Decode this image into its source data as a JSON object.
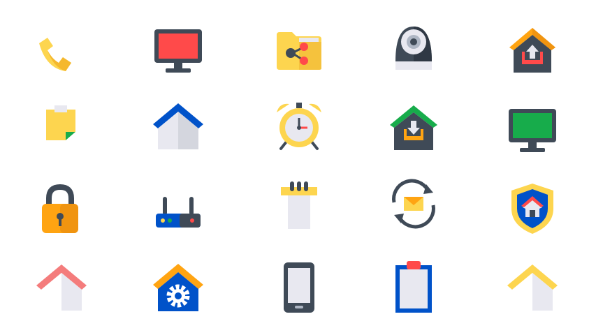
{
  "icons": [
    {
      "name": "phone-icon"
    },
    {
      "name": "monitor-red-icon"
    },
    {
      "name": "folder-share-icon"
    },
    {
      "name": "security-camera-icon"
    },
    {
      "name": "house-upload-icon"
    },
    {
      "name": "sticky-note-icon"
    },
    {
      "name": "house-blue-roof-icon"
    },
    {
      "name": "alarm-clock-icon"
    },
    {
      "name": "house-download-icon"
    },
    {
      "name": "monitor-green-icon"
    },
    {
      "name": "padlock-icon"
    },
    {
      "name": "router-icon"
    },
    {
      "name": "notepad-icon"
    },
    {
      "name": "mail-sync-icon"
    },
    {
      "name": "home-shield-icon"
    },
    {
      "name": "house-red-roof-icon"
    },
    {
      "name": "house-settings-icon"
    },
    {
      "name": "smartphone-icon"
    },
    {
      "name": "clipboard-icon"
    },
    {
      "name": "house-yellow-roof-icon"
    }
  ],
  "colors": {
    "yellow": "#FDD54F",
    "orange": "#FFA412",
    "red": "#FF4A4A",
    "green": "#17AC4B",
    "blue": "#0052C9",
    "dark": "#3F4A57",
    "light": "#E8E8F0",
    "white": "#FFFFFF"
  }
}
